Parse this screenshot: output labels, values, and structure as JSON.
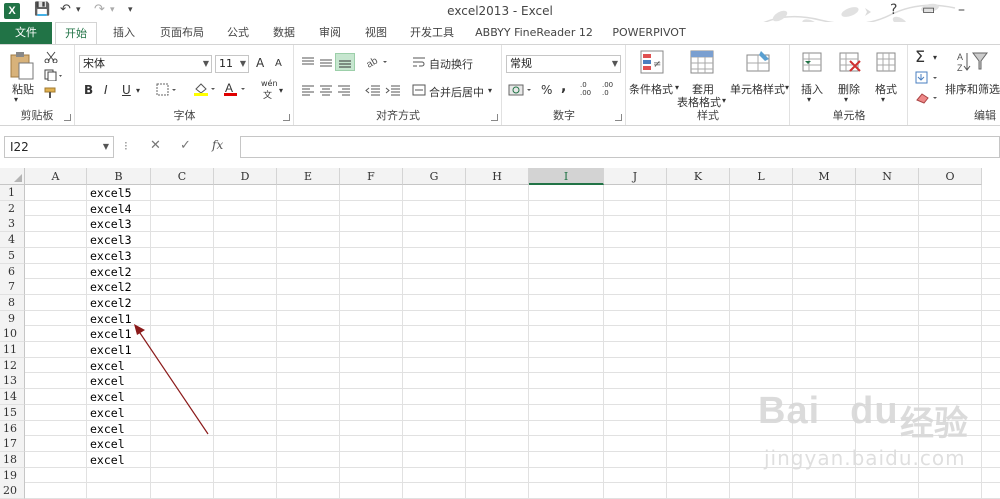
{
  "window": {
    "title": "excel2013 - Excel",
    "controls": {
      "help": "?",
      "ribbon_display": "▭",
      "minimize": "–"
    }
  },
  "quick_access": {
    "save": "💾",
    "undo": "↶",
    "undo_dd": "▾",
    "redo": "↷",
    "redo_dd": "▾",
    "customize": "▾"
  },
  "tabs": [
    {
      "label": "文件",
      "active": false,
      "file": true
    },
    {
      "label": "开始",
      "active": true
    },
    {
      "label": "插入"
    },
    {
      "label": "页面布局"
    },
    {
      "label": "公式"
    },
    {
      "label": "数据"
    },
    {
      "label": "审阅"
    },
    {
      "label": "视图"
    },
    {
      "label": "开发工具"
    },
    {
      "label": "ABBYY FineReader 12"
    },
    {
      "label": "POWERPIVOT"
    }
  ],
  "ribbon": {
    "clipboard": {
      "label": "剪贴板",
      "paste": "粘贴"
    },
    "font": {
      "label": "字体",
      "name": "宋体",
      "size": "11",
      "bold": "B",
      "italic": "I",
      "underline": "U",
      "grow": "A",
      "shrink": "A",
      "wen": "wén",
      "wen_sub": "文"
    },
    "alignment": {
      "label": "对齐方式",
      "wrap": "自动换行",
      "merge": "合并后居中"
    },
    "number": {
      "label": "数字",
      "format": "常规",
      "percent": "%",
      "comma": ",",
      "inc_dec": ".0 .00",
      "dec_dec": ".00 .0"
    },
    "styles": {
      "label": "样式",
      "conditional": "条件格式",
      "table1": "套用",
      "table2": "表格格式",
      "cell_styles": "单元格样式"
    },
    "cells": {
      "label": "单元格",
      "insert": "插入",
      "delete": "删除",
      "format": "格式"
    },
    "editing": {
      "label": "编辑",
      "sort": "排序和筛选"
    }
  },
  "formula_bar": {
    "name_box": "I22",
    "sep": "⁝",
    "cancel": "✕",
    "enter": "✓",
    "fx": "fx",
    "value": ""
  },
  "columns": [
    "A",
    "B",
    "C",
    "D",
    "E",
    "F",
    "G",
    "H",
    "I",
    "J",
    "K",
    "L",
    "M",
    "N",
    "O"
  ],
  "selected_column": "I",
  "rows": [
    "1",
    "2",
    "3",
    "4",
    "5",
    "6",
    "7",
    "8",
    "9",
    "10",
    "11",
    "12",
    "13",
    "14",
    "15",
    "16",
    "17",
    "18",
    "19",
    "20"
  ],
  "column_b_values": [
    "excel5",
    "excel4",
    "excel3",
    "excel3",
    "excel3",
    "excel2",
    "excel2",
    "excel2",
    "excel1",
    "excel1",
    "excel1",
    "excel",
    "excel",
    "excel",
    "excel",
    "excel",
    "excel",
    "excel"
  ],
  "watermark": {
    "logo": "Bai",
    "logo2": "du",
    "cn": "经验",
    "url": "jingyan.baidu.com"
  },
  "colors": {
    "accent": "#217346",
    "arrow": "#8b1a1a",
    "select_fill": "#c6e6cf"
  }
}
